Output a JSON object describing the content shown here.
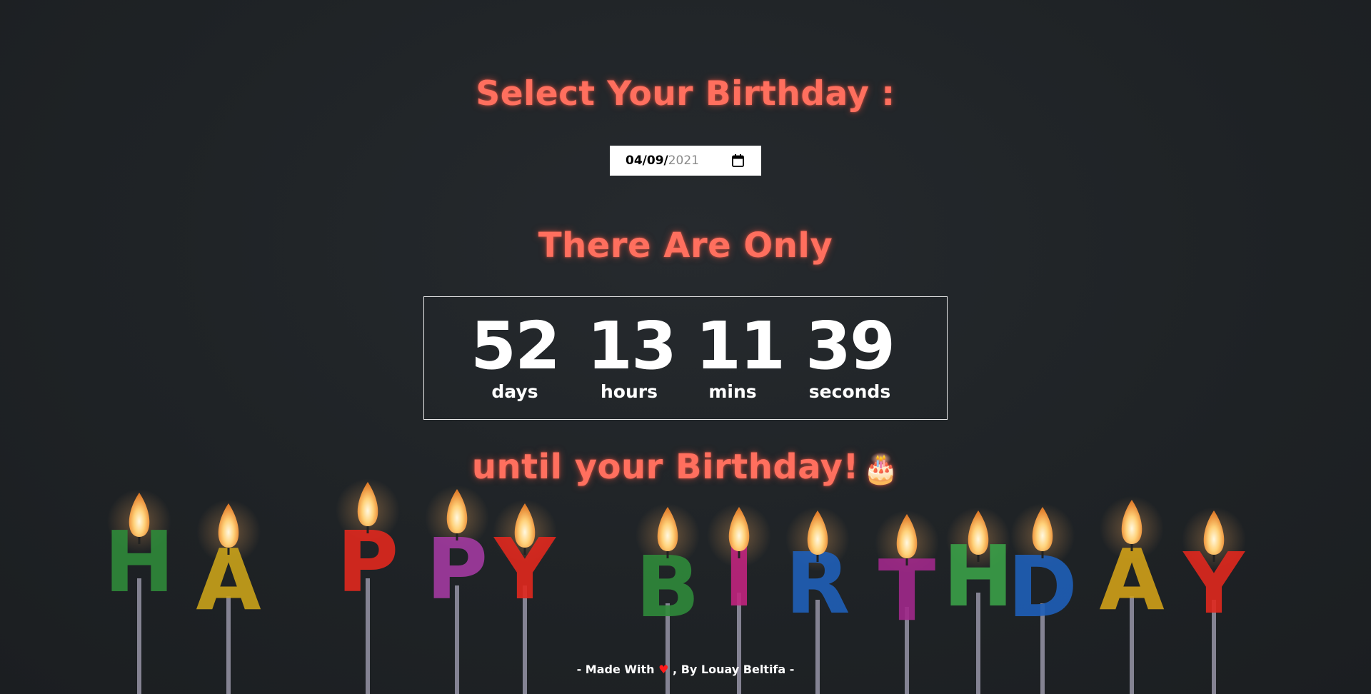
{
  "headings": {
    "select": "Select Your Birthday :",
    "only": "There Are Only",
    "until": "until your Birthday!",
    "cake_glyph": "🎂"
  },
  "date_input": {
    "month_day": "04/09/",
    "year": "2021",
    "icon": "calendar-icon"
  },
  "countdown": {
    "days": {
      "value": "52",
      "label": "days"
    },
    "hours": {
      "value": "13",
      "label": "hours"
    },
    "mins": {
      "value": "11",
      "label": "mins"
    },
    "seconds": {
      "value": "39",
      "label": "seconds"
    }
  },
  "footer": {
    "prefix": "- Made With ",
    "heart": "♥",
    "suffix": " , By Louay Beltifa -"
  },
  "candles": {
    "letters": [
      "H",
      "A",
      "P",
      "P",
      "Y",
      "B",
      "I",
      "R",
      "T",
      "H",
      "D",
      "A",
      "Y"
    ],
    "colors": [
      "#2f8a3a",
      "#c9a21a",
      "#e0281e",
      "#a23aa0",
      "#e0281e",
      "#2f8a3a",
      "#c0247e",
      "#1f5fb8",
      "#a0288a",
      "#3aa048",
      "#1f5fb8",
      "#d0a018",
      "#e0281e"
    ]
  },
  "theme": {
    "accent": "#ff6f5e",
    "background": "#1f2326"
  }
}
